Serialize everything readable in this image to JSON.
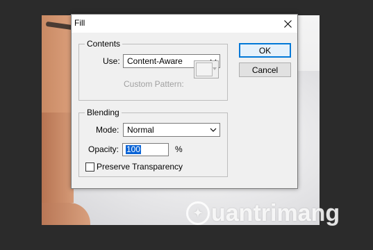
{
  "dialog": {
    "title": "Fill",
    "ok_label": "OK",
    "cancel_label": "Cancel"
  },
  "contents": {
    "legend": "Contents",
    "use_label": "Use:",
    "use_value": "Content-Aware",
    "custom_pattern_label": "Custom Pattern:"
  },
  "blending": {
    "legend": "Blending",
    "mode_label": "Mode:",
    "mode_value": "Normal",
    "opacity_label": "Opacity:",
    "opacity_value": "100",
    "opacity_unit": "%",
    "preserve_label": "Preserve Transparency",
    "preserve_checked": false
  },
  "background": {
    "watermark": "uantrimang"
  },
  "icons": {
    "close": "close-icon",
    "dropdown": "chevron-down-icon"
  },
  "colors": {
    "accent": "#0078d7",
    "selection": "#0a64d6"
  }
}
